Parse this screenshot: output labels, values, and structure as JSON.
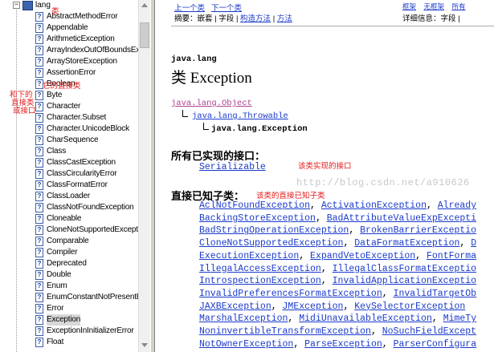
{
  "tree": {
    "root_label": "lang",
    "items": [
      "AbstractMethodError",
      "Appendable",
      "ArithmeticException",
      "ArrayIndexOutOfBoundsExc",
      "ArrayStoreException",
      "AssertionError",
      "Boolean",
      "Byte",
      "Character",
      "Character.Subset",
      "Character.UnicodeBlock",
      "CharSequence",
      "Class",
      "ClassCastException",
      "ClassCircularityError",
      "ClassFormatError",
      "ClassLoader",
      "ClassNotFoundException",
      "Cloneable",
      "CloneNotSupportedExcepti",
      "Comparable",
      "Compiler",
      "Deprecated",
      "Double",
      "Enum",
      "EnumConstantNotPresentE",
      "Error",
      "Exception",
      "ExceptionInInitializerError",
      "Float"
    ],
    "selected": "Exception",
    "icon_glyph": "?"
  },
  "nav": {
    "prev_label": "上一个类",
    "next_label": "下一个类",
    "frames_label": "框架",
    "noframes_label": "无框架",
    "all_label": "所有",
    "summary_prefix": "摘要：",
    "summary_nested": "嵌套",
    "summary_field": "字段",
    "summary_ctor": "构造方法",
    "summary_method": "方法",
    "detail_prefix": "详细信息：",
    "detail_field": "字段",
    "sep": "|"
  },
  "doc": {
    "package": "java.lang",
    "title": "类 Exception",
    "inheritance": [
      "java.lang.Object",
      "java.lang.Throwable",
      "java.lang.Exception"
    ],
    "interfaces_header": "所有已实现的接口：",
    "interfaces": [
      "Serializable"
    ],
    "subclasses_header": "直接已知子类：",
    "subclass_lines": [
      [
        "AclNotFoundException",
        "ActivationException",
        "Already"
      ],
      [
        "BackingStoreException",
        "BadAttributeValueExpExcepti"
      ],
      [
        "BadStringOperationException",
        "BrokenBarrierExceptio"
      ],
      [
        "CloneNotSupportedException",
        "DataFormatException",
        "D"
      ],
      [
        "ExecutionException",
        "ExpandVetoException",
        "FontForma"
      ],
      [
        "IllegalAccessException",
        "IllegalClassFormatExceptio"
      ],
      [
        "IntrospectionException",
        "InvalidApplicationExceptio"
      ],
      [
        "InvalidPreferencesFormatException",
        "InvalidTargetOb"
      ],
      [
        "JAXBException",
        "JMException",
        "KeySelectorException"
      ],
      [
        "MarshalException",
        "MidiUnavailableException",
        "MimeTy"
      ],
      [
        "NoninvertibleTransformException",
        "NoSuchFieldExcept"
      ],
      [
        "NotOwnerException",
        "ParseException",
        "ParserConfigura"
      ]
    ]
  },
  "annotations": {
    "tree_top": "类",
    "tree_parent": "它的直接类",
    "tree_sub_line1": "和下的",
    "tree_sub_line2": "直接类",
    "tree_sub_line3": "或接口",
    "interfaces_note": "该类实现的接口",
    "subclasses_note": "该类的直接已知子类"
  },
  "watermark": "http://blog.csdn.net/a910626",
  "colors": {
    "link": "#1a3acb",
    "visited_link": "#b04090",
    "annotation": "#e21b1b"
  }
}
